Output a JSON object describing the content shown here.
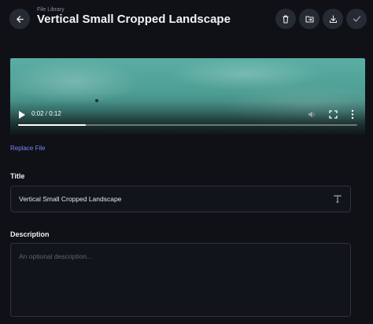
{
  "header": {
    "breadcrumb": "File Library",
    "title": "Vertical Small Cropped Landscape",
    "back_icon": "arrow-left-icon",
    "actions": [
      "trash-icon",
      "folder-move-icon",
      "download-icon",
      "check-icon"
    ]
  },
  "video": {
    "time": "0:02 / 0:12",
    "progress": 0.2
  },
  "replace_label": "Replace File",
  "title_field": {
    "label": "Title",
    "value": "Vertical Small Cropped Landscape",
    "icon": "text-type-icon"
  },
  "description_field": {
    "label": "Description",
    "placeholder": "An optional description..."
  },
  "colors": {
    "background": "#0f1117",
    "accent": "#7b84f5",
    "button": "#262a33"
  }
}
